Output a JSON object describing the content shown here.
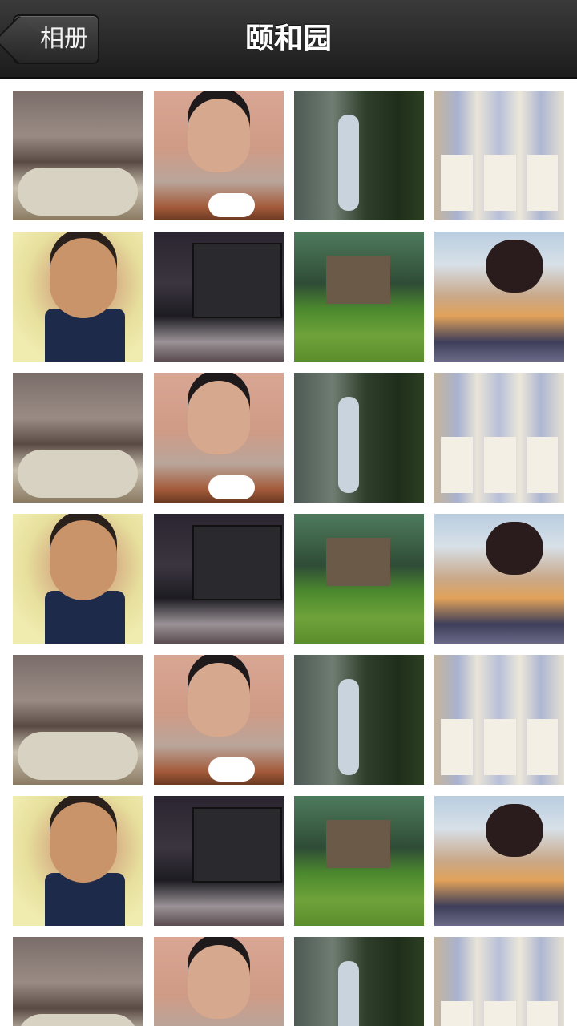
{
  "navbar": {
    "back_label": "相册",
    "title": "颐和园"
  },
  "thumbnails": {
    "columns": 4,
    "rows": 7,
    "visible_photo_pattern": [
      [
        "family-dinner",
        "guy-at-table",
        "waterfall-girl",
        "child-with-guitar"
      ],
      [
        "smiling-guy",
        "studio-speakers",
        "garden-path",
        "woman-on-beach"
      ]
    ]
  }
}
